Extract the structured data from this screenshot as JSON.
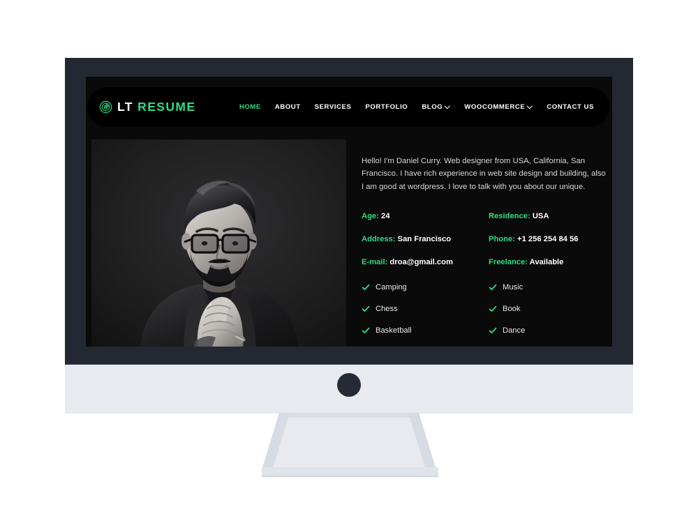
{
  "site": {
    "brand_primary": "LT",
    "brand_secondary": "RESUME",
    "accent_color": "#2fdd84",
    "logo_icon": "circular-badge-icon"
  },
  "nav": {
    "items": [
      {
        "label": "HOME",
        "active": true,
        "caret": false
      },
      {
        "label": "ABOUT",
        "active": false,
        "caret": false
      },
      {
        "label": "SERVICES",
        "active": false,
        "caret": false
      },
      {
        "label": "PORTFOLIO",
        "active": false,
        "caret": false
      },
      {
        "label": "BLOG",
        "active": false,
        "caret": true
      },
      {
        "label": "WOOCOMMERCE",
        "active": false,
        "caret": true
      },
      {
        "label": "CONTACT US",
        "active": false,
        "caret": false
      }
    ]
  },
  "hero": {
    "photo_alt": "black-and-white portrait of bearded man with glasses in suit",
    "intro": "Hello! I'm Daniel Curry. Web designer from USA, California, San Francisco. I have rich experience in web site design and building, also I am good at wordpress. I love to talk with you about our unique.",
    "info": [
      {
        "label": "Age:",
        "value": "24"
      },
      {
        "label": "Residence:",
        "value": "USA"
      },
      {
        "label": "Address:",
        "value": "San Francisco"
      },
      {
        "label": "Phone:",
        "value": "+1 256 254 84 56"
      },
      {
        "label": "E-mail:",
        "value": "droa@gmail.com"
      },
      {
        "label": "Freelance:",
        "value": "Available"
      }
    ],
    "hobbies": [
      {
        "label": "Camping"
      },
      {
        "label": "Music"
      },
      {
        "label": "Chess"
      },
      {
        "label": "Book"
      },
      {
        "label": "Basketball"
      },
      {
        "label": "Dance"
      }
    ]
  }
}
